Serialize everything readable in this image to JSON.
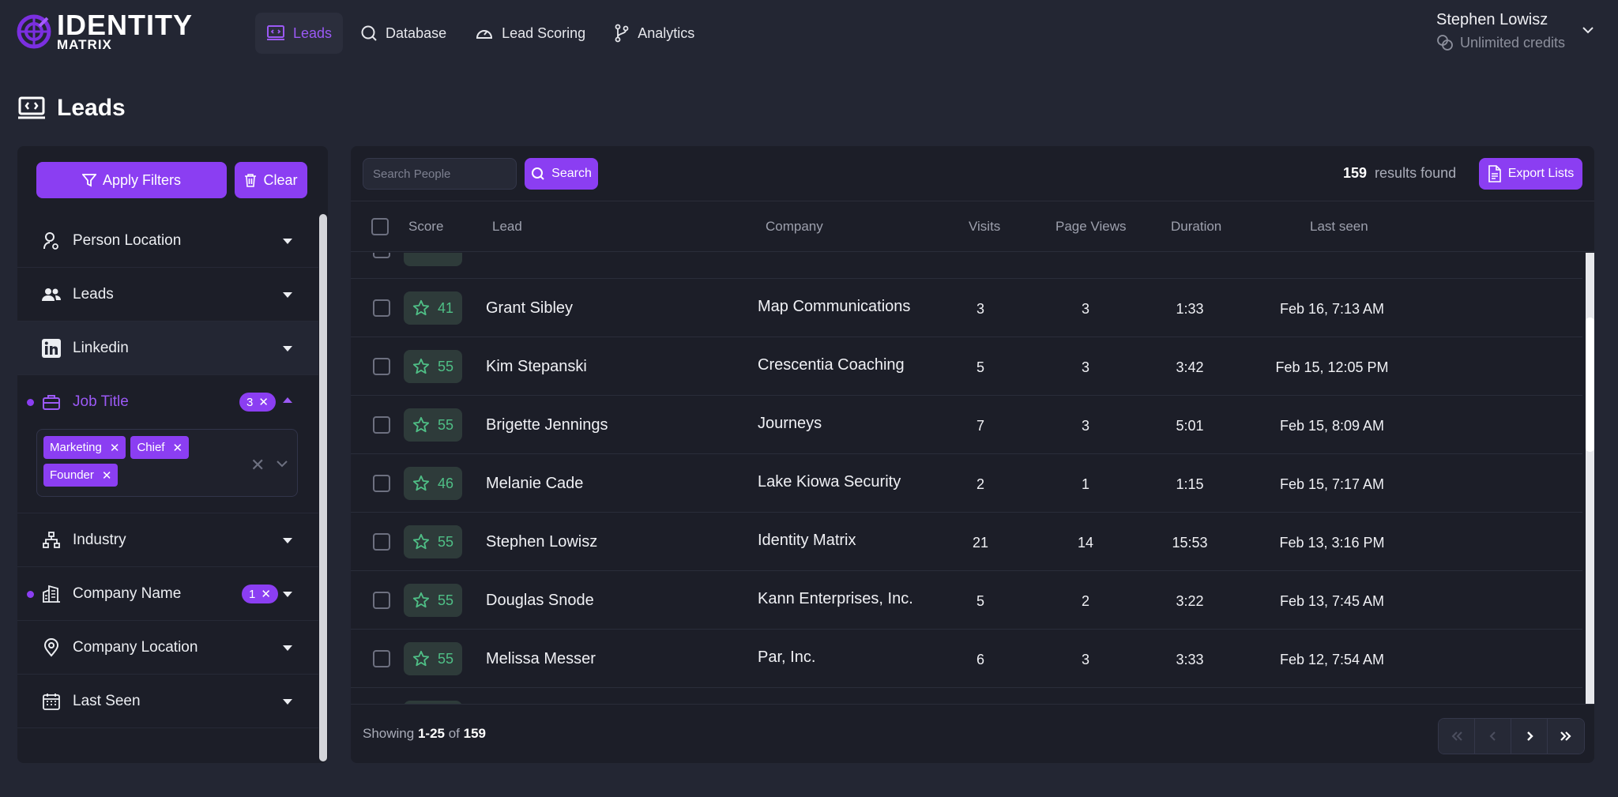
{
  "brand": {
    "line1": "IDENTITY",
    "line2": "MATRIX"
  },
  "nav": [
    {
      "label": "Leads",
      "icon": "monitor-code-icon",
      "active": true
    },
    {
      "label": "Database",
      "icon": "search-icon",
      "active": false
    },
    {
      "label": "Lead Scoring",
      "icon": "gauge-icon",
      "active": false
    },
    {
      "label": "Analytics",
      "icon": "branch-icon",
      "active": false
    }
  ],
  "user": {
    "name": "Stephen Lowisz",
    "credits": "Unlimited credits"
  },
  "page": {
    "title": "Leads"
  },
  "sidebar": {
    "apply_label": "Apply Filters",
    "clear_label": "Clear",
    "filters": [
      {
        "label": "Person Location",
        "icon": "person-pin-icon"
      },
      {
        "label": "Leads",
        "icon": "users-icon"
      },
      {
        "label": "Linkedin",
        "icon": "linkedin-icon"
      },
      {
        "label": "Job Title",
        "icon": "briefcase-icon",
        "count": "3",
        "tags": [
          "Marketing",
          "Chief",
          "Founder"
        ]
      },
      {
        "label": "Industry",
        "icon": "hierarchy-icon"
      },
      {
        "label": "Company Name",
        "icon": "buildings-icon",
        "count": "1"
      },
      {
        "label": "Company Location",
        "icon": "map-pin-icon"
      },
      {
        "label": "Last Seen",
        "icon": "calendar-icon"
      }
    ]
  },
  "toolbar": {
    "search_placeholder": "Search People",
    "search_label": "Search",
    "results_count": "159",
    "results_label": "results found",
    "export_label": "Export Lists"
  },
  "table": {
    "headers": {
      "score": "Score",
      "lead": "Lead",
      "company": "Company",
      "visits": "Visits",
      "page_views": "Page Views",
      "duration": "Duration",
      "last_seen": "Last seen"
    },
    "rows": [
      {
        "score": "41",
        "lead": "Grant Sibley",
        "company": "Map Communications",
        "visits": "3",
        "page_views": "3",
        "duration": "1:33",
        "last_seen": "Feb 16, 7:13 AM"
      },
      {
        "score": "55",
        "lead": "Kim Stepanski",
        "company": "Crescentia Coaching",
        "visits": "5",
        "page_views": "3",
        "duration": "3:42",
        "last_seen": "Feb 15, 12:05 PM"
      },
      {
        "score": "55",
        "lead": "Brigette Jennings",
        "company": "Journeys",
        "visits": "7",
        "page_views": "3",
        "duration": "5:01",
        "last_seen": "Feb 15, 8:09 AM"
      },
      {
        "score": "46",
        "lead": "Melanie Cade",
        "company": "Lake Kiowa Security",
        "visits": "2",
        "page_views": "1",
        "duration": "1:15",
        "last_seen": "Feb 15, 7:17 AM"
      },
      {
        "score": "55",
        "lead": "Stephen Lowisz",
        "company": "Identity Matrix",
        "visits": "21",
        "page_views": "14",
        "duration": "15:53",
        "last_seen": "Feb 13, 3:16 PM"
      },
      {
        "score": "55",
        "lead": "Douglas Snode",
        "company": "Kann Enterprises, Inc.",
        "visits": "5",
        "page_views": "2",
        "duration": "3:22",
        "last_seen": "Feb 13, 7:45 AM"
      },
      {
        "score": "55",
        "lead": "Melissa Messer",
        "company": "Par, Inc.",
        "visits": "6",
        "page_views": "3",
        "duration": "3:33",
        "last_seen": "Feb 12, 7:54 AM"
      }
    ]
  },
  "pagination": {
    "prefix": "Showing",
    "range": "1-25",
    "of": "of",
    "total": "159"
  },
  "colors": {
    "accent": "#8b3ef2",
    "score_green": "#4fbf86",
    "bg": "#232633",
    "panel": "#1c1e28"
  }
}
